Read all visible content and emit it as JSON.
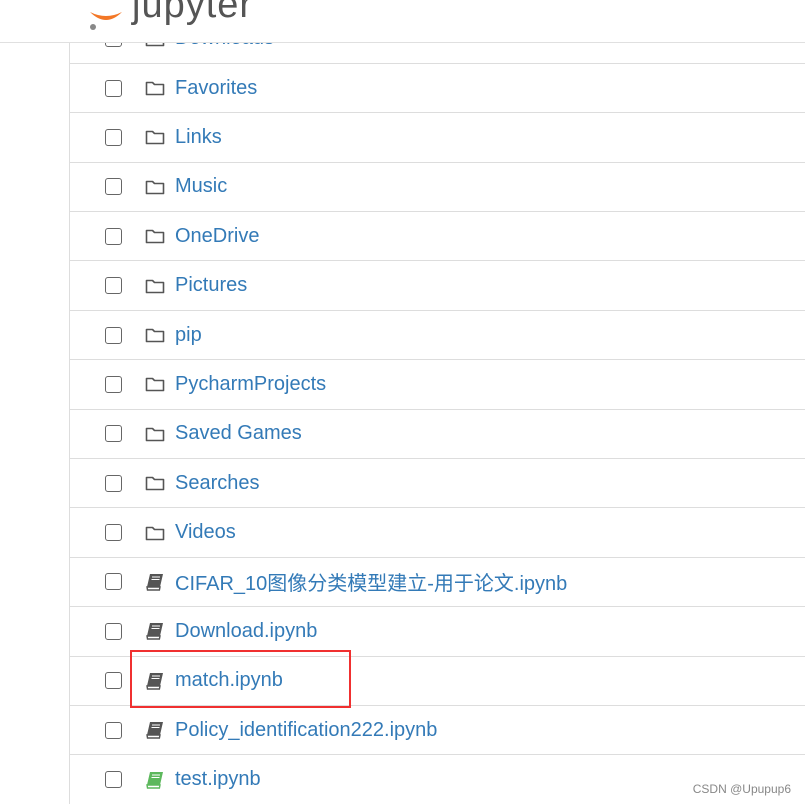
{
  "header": {
    "logo_text": "jupyter"
  },
  "files": [
    {
      "name": "Downloads",
      "type": "folder"
    },
    {
      "name": "Favorites",
      "type": "folder"
    },
    {
      "name": "Links",
      "type": "folder"
    },
    {
      "name": "Music",
      "type": "folder"
    },
    {
      "name": "OneDrive",
      "type": "folder"
    },
    {
      "name": "Pictures",
      "type": "folder"
    },
    {
      "name": "pip",
      "type": "folder"
    },
    {
      "name": "PycharmProjects",
      "type": "folder"
    },
    {
      "name": "Saved Games",
      "type": "folder"
    },
    {
      "name": "Searches",
      "type": "folder"
    },
    {
      "name": "Videos",
      "type": "folder"
    },
    {
      "name": "CIFAR_10图像分类模型建立-用于论文.ipynb",
      "type": "notebook"
    },
    {
      "name": "Download.ipynb",
      "type": "notebook"
    },
    {
      "name": "match.ipynb",
      "type": "notebook",
      "highlighted": true
    },
    {
      "name": "Policy_identification222.ipynb",
      "type": "notebook"
    },
    {
      "name": "test.ipynb",
      "type": "notebook",
      "running": true
    }
  ],
  "colors": {
    "link": "#337ab7",
    "notebook_icon": "#555555",
    "running_icon": "#5cb85c",
    "highlight": "#f03030",
    "logo_orange": "#f37726"
  },
  "watermark": "CSDN @Upupup6"
}
